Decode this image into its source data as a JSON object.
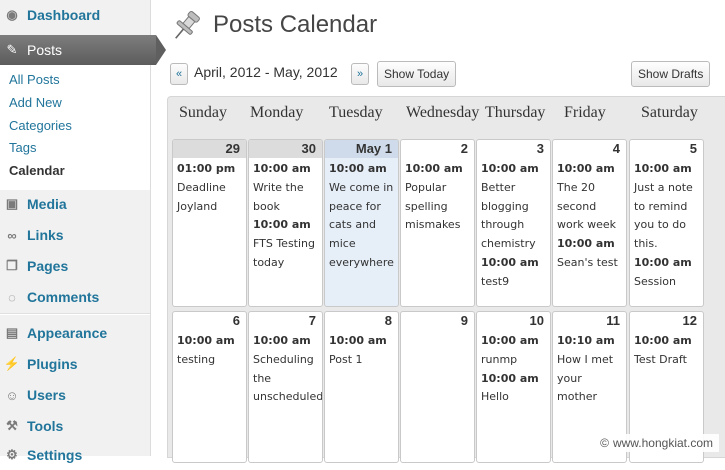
{
  "sidebar": {
    "dashboard": "Dashboard",
    "posts": "Posts",
    "posts_sub": [
      "All Posts",
      "Add New",
      "Categories",
      "Tags",
      "Calendar"
    ],
    "menu": [
      "Media",
      "Links",
      "Pages",
      "Comments",
      "Appearance",
      "Plugins",
      "Users",
      "Tools",
      "Settings"
    ]
  },
  "header": {
    "title": "Posts Calendar"
  },
  "toolbar": {
    "prev": "«",
    "next": "»",
    "range": "April, 2012 - May, 2012",
    "show_today": "Show Today",
    "show_drafts": "Show Drafts"
  },
  "calendar": {
    "days": [
      "Sunday",
      "Monday",
      "Tuesday",
      "Wednesday",
      "Thursday",
      "Friday",
      "Saturday"
    ],
    "week1": [
      {
        "num": "29",
        "events": [
          [
            "01:00 pm",
            "Deadline Joyland"
          ]
        ]
      },
      {
        "num": "30",
        "events": [
          [
            "10:00 am",
            "Write the book"
          ],
          [
            "10:00 am",
            "FTS Testing today"
          ]
        ]
      },
      {
        "num": "May 1",
        "events": [
          [
            "10:00 am",
            "We come in peace for cats and mice everywhere"
          ]
        ]
      },
      {
        "num": "2",
        "events": [
          [
            "10:00 am",
            "Popular spelling mismakes"
          ]
        ]
      },
      {
        "num": "3",
        "events": [
          [
            "10:00 am",
            "Better blogging through chemistry"
          ],
          [
            "10:00 am",
            "test9"
          ]
        ]
      },
      {
        "num": "4",
        "events": [
          [
            "10:00 am",
            "The 20 second work week"
          ],
          [
            "10:00 am",
            "Sean's test"
          ]
        ]
      },
      {
        "num": "5",
        "events": [
          [
            "10:00 am",
            "Just a note to remind you to do this."
          ],
          [
            "10:00 am",
            "Session"
          ]
        ]
      }
    ],
    "week2": [
      {
        "num": "6",
        "events": [
          [
            "10:00 am",
            "testing"
          ]
        ]
      },
      {
        "num": "7",
        "events": [
          [
            "10:00 am",
            "Scheduling the unscheduled"
          ]
        ]
      },
      {
        "num": "8",
        "events": [
          [
            "10:00 am",
            "Post 1"
          ]
        ]
      },
      {
        "num": "9",
        "events": []
      },
      {
        "num": "10",
        "events": [
          [
            "10:00 am",
            "runmp"
          ],
          [
            "10:00 am",
            "Hello"
          ]
        ]
      },
      {
        "num": "11",
        "events": [
          [
            "10:10 am",
            "How I met your mother"
          ]
        ]
      },
      {
        "num": "12",
        "events": [
          [
            "10:00 am",
            "Test Draft"
          ]
        ]
      }
    ]
  },
  "watermark": "www.hongkiat.com"
}
